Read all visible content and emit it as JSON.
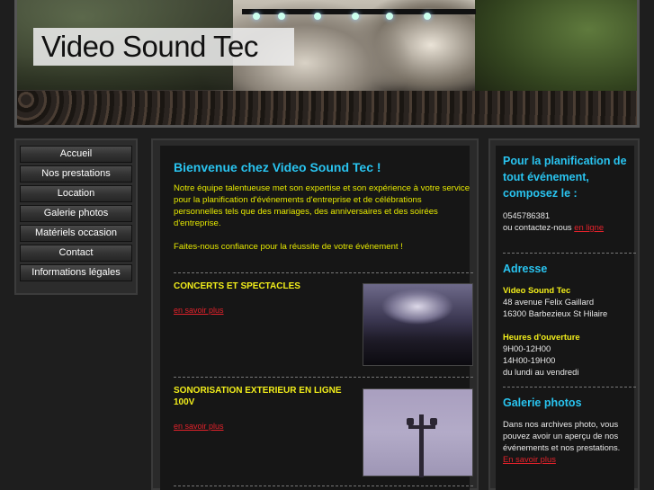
{
  "header": {
    "site_title": "Video Sound Tec"
  },
  "nav": {
    "items": [
      {
        "label": "Accueil"
      },
      {
        "label": "Nos prestations"
      },
      {
        "label": "Location"
      },
      {
        "label": "Galerie photos"
      },
      {
        "label": "Matériels occasion"
      },
      {
        "label": "Contact"
      },
      {
        "label": "Informations légales"
      }
    ]
  },
  "main": {
    "welcome_title": "Bienvenue chez Video Sound Tec !",
    "intro": "Notre équipe talentueuse met son expertise et son expérience à votre service pour la planification d'événements d'entreprise et de célébrations personnelles tels que des mariages, des anniversaires et des soirées d'entreprise.",
    "cta": "Faites-nous confiance pour la réussite de votre événement !",
    "sections": [
      {
        "title": "CONCERTS ET SPECTACLES",
        "link": "en savoir plus"
      },
      {
        "title": "SONORISATION EXTERIEUR EN LIGNE 100V",
        "link": "en savoir plus"
      }
    ]
  },
  "sidebar": {
    "planning_heading": "Pour la planification de tout événement, composez le :",
    "phone": "0545786381",
    "contact_prefix": "ou contactez-nous",
    "contact_link": "en ligne",
    "address_heading": "Adresse",
    "company": "Video Sound Tec",
    "street": "48 avenue Felix Gaillard",
    "city": "16300 Barbezieux St Hilaire",
    "hours_heading": "Heures d'ouverture",
    "hours_morning": " 9H00-12H00",
    "hours_afternoon": " 14H00-19H00",
    "days": "du lundi au vendredi",
    "gallery_heading": "Galerie photos",
    "gallery_text": "Dans nos archives photo, vous pouvez avoir un aperçu de nos événements et nos prestations.",
    "gallery_link": "En savoir plus"
  },
  "colors": {
    "accent_blue": "#29c4f0",
    "text_yellow": "#e5e800",
    "link_red": "#e3222b",
    "background": "#1e1e1e"
  }
}
